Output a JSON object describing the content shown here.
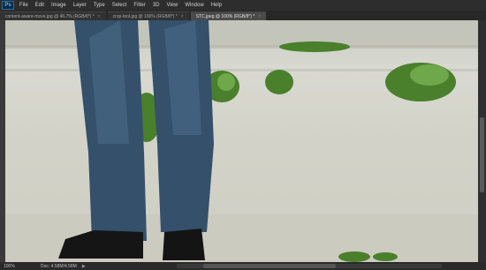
{
  "app": {
    "logo": "Ps",
    "menu": [
      "File",
      "Edit",
      "Image",
      "Layer",
      "Type",
      "Select",
      "Filter",
      "3D",
      "View",
      "Window",
      "Help"
    ]
  },
  "tabs": [
    {
      "label": "content-aware-move.jpg @ 46.7% (RGB/8*) *",
      "active": false
    },
    {
      "label": "crop-tool.jpg @ 100% (RGB/8*) *",
      "active": false
    },
    {
      "label": "STC.jpeg @ 100% (RGB/8*) *",
      "active": true
    }
  ],
  "status": {
    "zoom": "100%",
    "doc": "Doc: 4.58M/4.58M",
    "arrow": "▶"
  },
  "colors": {
    "jeans": "#35506a",
    "ground": "#d2d2c8",
    "grass": "#4b8a2e"
  }
}
